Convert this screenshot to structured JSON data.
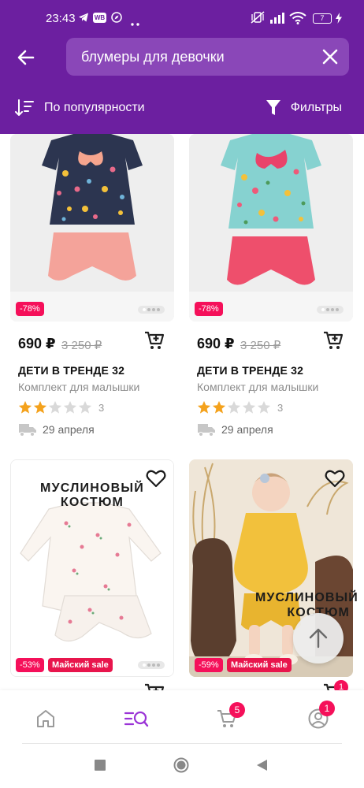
{
  "status_bar": {
    "time": "23:43",
    "wb_badge": "WB",
    "battery": "7"
  },
  "header": {
    "search_value": "блумеры для девочки",
    "sort_label": "По популярности",
    "filter_label": "Фильтры"
  },
  "products": [
    {
      "discount": "-78%",
      "price": "690 ₽",
      "old_price": "3 250 ₽",
      "brand": "ДЕТИ В ТРЕНДЕ 32",
      "name": "Комплект для малышки",
      "rating": 2,
      "rating_count": "3",
      "delivery": "29 апреля"
    },
    {
      "discount": "-78%",
      "price": "690 ₽",
      "old_price": "3 250 ₽",
      "brand": "ДЕТИ В ТРЕНДЕ 32",
      "name": "Комплект для малышки",
      "rating": 2,
      "rating_count": "3",
      "delivery": "29 апреля"
    },
    {
      "image_caption": "МУСЛИНОВЫЙ КОСТЮМ",
      "discount": "-53%",
      "sale_badge": "Майский sale"
    },
    {
      "image_caption_line1": "МУСЛИНОВЫЙ",
      "image_caption_line2": "КОСТЮМ",
      "discount": "-59%",
      "sale_badge": "Майский sale"
    }
  ],
  "bottom_nav": {
    "cart_count": "5",
    "profile_count": "1",
    "partial_card_badge": "1"
  },
  "colors": {
    "brand_purple": "#6c1fa0",
    "discount_pink": "#f5105a",
    "star_gold": "#f4a21d"
  }
}
